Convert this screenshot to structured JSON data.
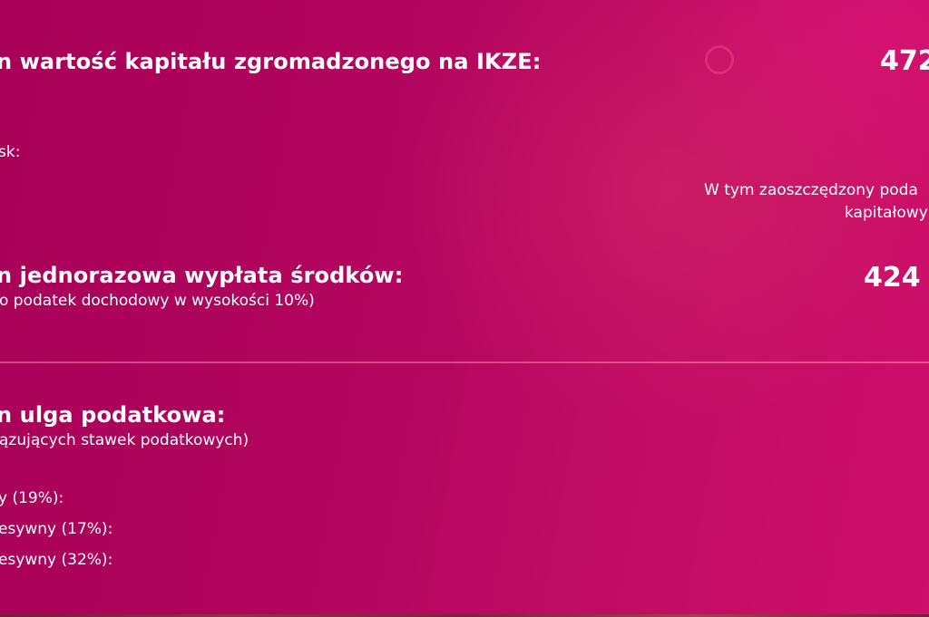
{
  "summary": {
    "capital_label": "n wartość kapitału zgromadzonego na IKZE:",
    "capital_value": "472",
    "profit_label": "sk:",
    "saved_tax_line1": "W tym zaoszczędzony poda",
    "saved_tax_line2": "kapitałowy",
    "payout_label": "n jednorazowa wypłata środków:",
    "payout_note": "o podatek dochodowy w wysokości 10%)",
    "payout_value": "424"
  },
  "tax_relief": {
    "title": "n ulga podatkowa:",
    "note": "ązujących stawek podatkowych)",
    "rows": [
      {
        "label": "y (19%):"
      },
      {
        "label": "esywny (17%):"
      },
      {
        "label": "esywny (32%):"
      }
    ]
  },
  "colors": {
    "background_start": "#a80058",
    "background_end": "#cf0f6a",
    "text": "#ffffff"
  }
}
